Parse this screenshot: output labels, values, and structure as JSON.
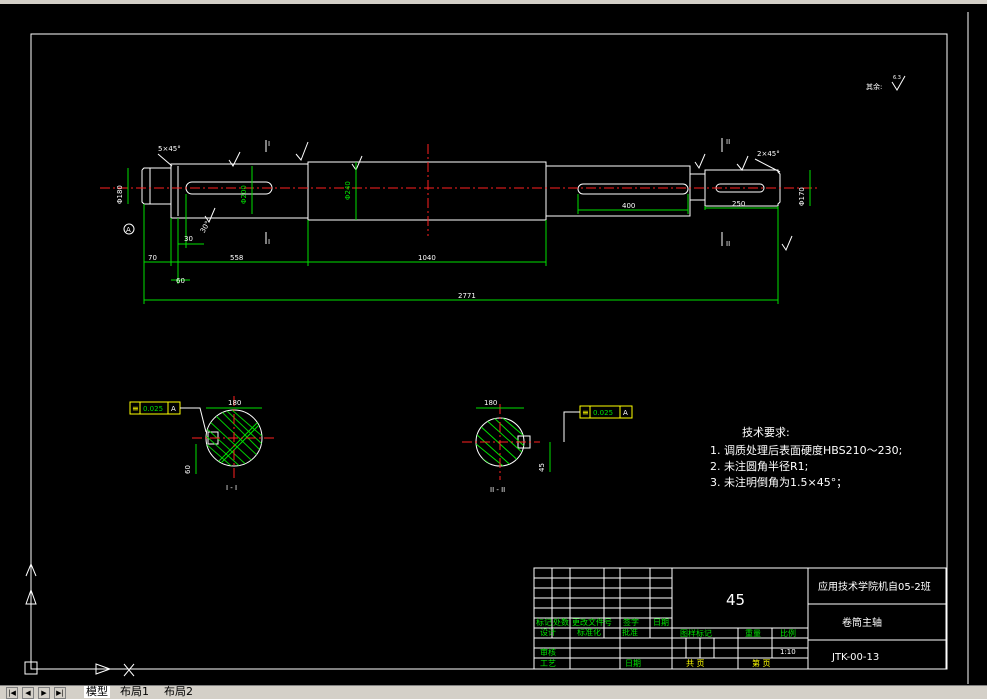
{
  "drawing": {
    "roughness_note": "其余:",
    "roughness_value": "6.3",
    "chamfer_left": "5×45°",
    "chamfer_right": "2×45°",
    "dims": {
      "d70": "70",
      "d60": "60",
      "d30": "30",
      "d558": "558",
      "d1040": "1040",
      "d400": "400",
      "d250": "250",
      "d2771": "2771",
      "dia200": "Φ200",
      "dia240": "Φ240",
      "dia180": "Φ180",
      "dia170": "Φ170",
      "ang30": "30°"
    },
    "section_labels": {
      "left_marker": "I",
      "right_marker": "II",
      "left_name": "I - I",
      "right_name": "II - II"
    },
    "section_dims": {
      "left_width": "180",
      "right_width": "180",
      "left_depth": "60",
      "right_depth": "45"
    },
    "tolerance_left": {
      "symbol": "≡",
      "value": "0.025",
      "datum": "A"
    },
    "tolerance_right": {
      "symbol": "≡",
      "value": "0.025",
      "datum": "A"
    },
    "tech_title": "技术要求:",
    "tech_items": [
      "1. 调质处理后表面硬度HBS210～230;",
      "2. 未注圆角半径R1;",
      "3. 未注明倒角为1.5×45°；"
    ]
  },
  "title_block": {
    "material": "45",
    "school": "应用技术学院机自05-2班",
    "part_name": "卷筒主轴",
    "code": "JTK-00-13",
    "scale_label": "比例",
    "scale": "1:10",
    "weight_label": "重量",
    "stage_label": "图样标记",
    "sheets_total": "共    页",
    "sheet_no": "第    页",
    "rows": {
      "mark": "标记",
      "count": "处数",
      "change_file": "更改文件号",
      "signature": "签字",
      "date": "日期",
      "design": "设计",
      "standard": "标准化",
      "check": "审核",
      "craft": "工艺",
      "approve": "批准",
      "date2": "日期"
    }
  },
  "tabs": {
    "model": "模型",
    "layout1": "布局1",
    "layout2": "布局2"
  },
  "colors": {
    "background": "#000000",
    "geometry": "#ffffff",
    "dimension": "#00e000",
    "center_line": "#ff2020",
    "hatch": "#ffff00"
  }
}
